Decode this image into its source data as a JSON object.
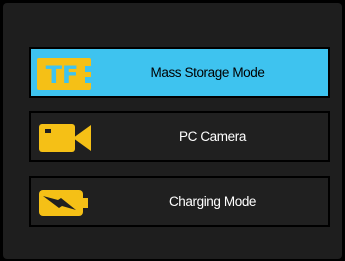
{
  "menu": {
    "items": [
      {
        "label": "Mass Storage Mode",
        "icon": "tf-card-icon",
        "selected": true
      },
      {
        "label": "PC Camera",
        "icon": "video-camera-icon",
        "selected": false
      },
      {
        "label": "Charging Mode",
        "icon": "battery-charging-icon",
        "selected": false
      }
    ]
  },
  "tf_card": {
    "text": "TF"
  },
  "colors": {
    "background": "#1e1e1e",
    "outer": "#000000",
    "item_background": "#202020",
    "selected_background": "#3ec3ef",
    "icon_yellow": "#f5c016",
    "text": "#ffffff",
    "selected_text": "#000000"
  }
}
